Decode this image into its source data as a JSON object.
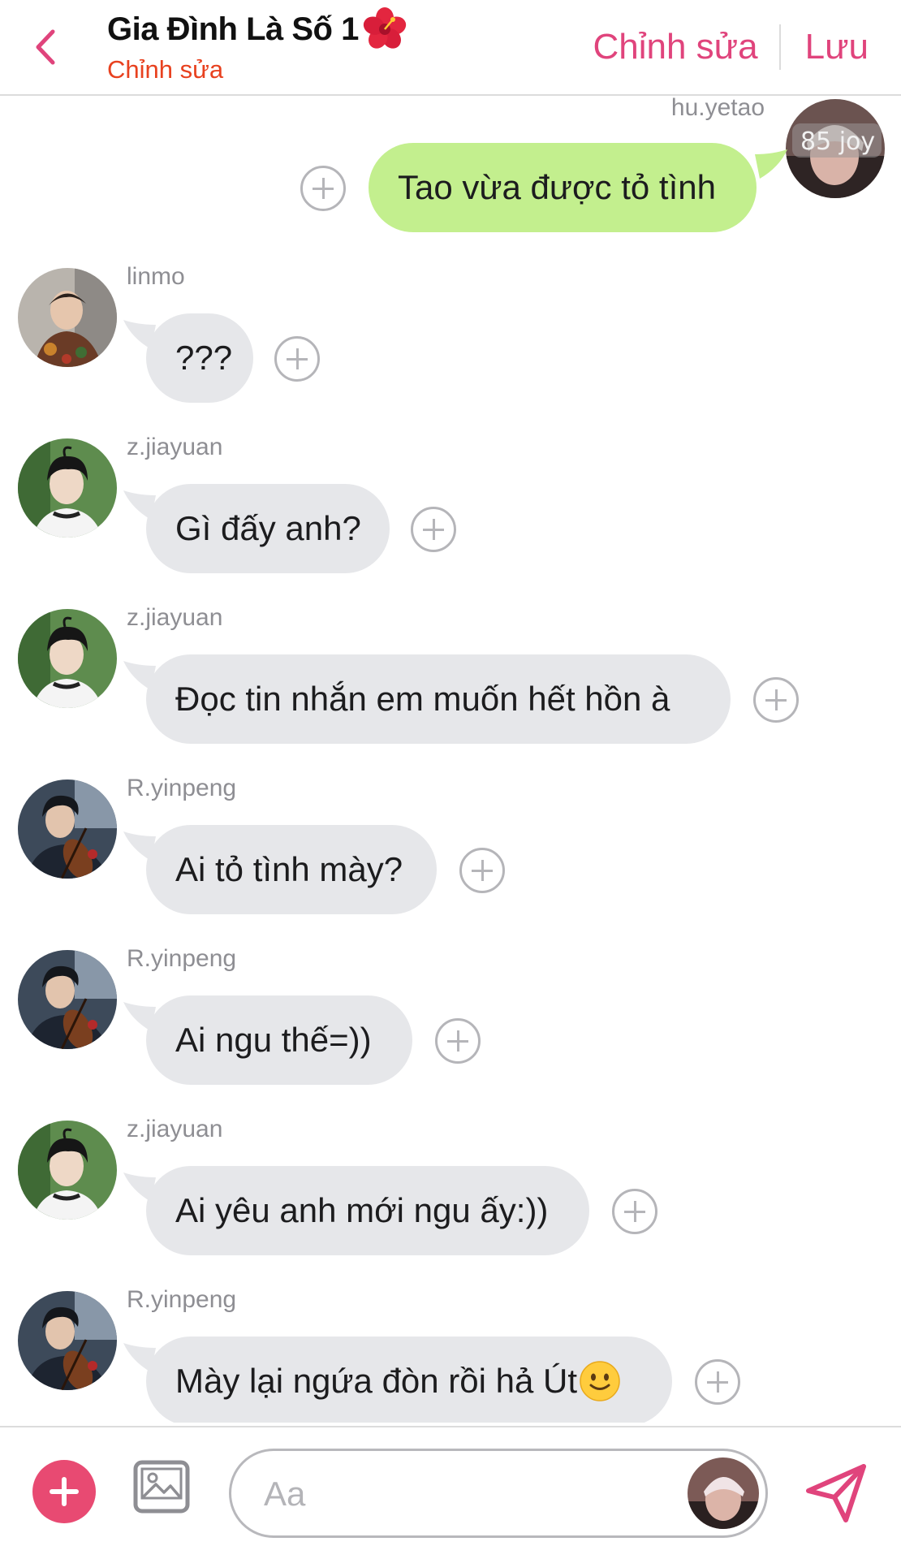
{
  "header": {
    "title": "Gia Đình Là Số 1",
    "subtitle": "Chỉnh sửa",
    "edit_label": "Chỉnh sửa",
    "save_label": "Lưu",
    "accent_color": "#e0447c"
  },
  "messages": [
    {
      "sender": "hu.yetao",
      "text": "Tao vừa được tỏ tình",
      "outgoing": true
    },
    {
      "sender": "linmo",
      "text": "???",
      "outgoing": false
    },
    {
      "sender": "z.jiayuan",
      "text": "Gì đấy anh?",
      "outgoing": false
    },
    {
      "sender": "z.jiayuan",
      "text": "Đọc tin nhắn em muốn hết hồn à",
      "outgoing": false
    },
    {
      "sender": "R.yinpeng",
      "text": "Ai tỏ tình mày?",
      "outgoing": false
    },
    {
      "sender": "R.yinpeng",
      "text": "Ai ngu thế=))",
      "outgoing": false
    },
    {
      "sender": "z.jiayuan",
      "text": "Ai yêu anh mới ngu ấy:))",
      "outgoing": false
    },
    {
      "sender": "R.yinpeng",
      "text": "Mày lại ngứa đòn rồi hả Út",
      "outgoing": false
    }
  ],
  "hu_yetao_avatar_text": "85 joy",
  "composer": {
    "placeholder": "Aa"
  },
  "icons": {
    "back": "chevron-left-icon",
    "add": "plus-icon",
    "gallery": "image-icon",
    "send": "send-icon",
    "react": "add-reaction-icon"
  }
}
